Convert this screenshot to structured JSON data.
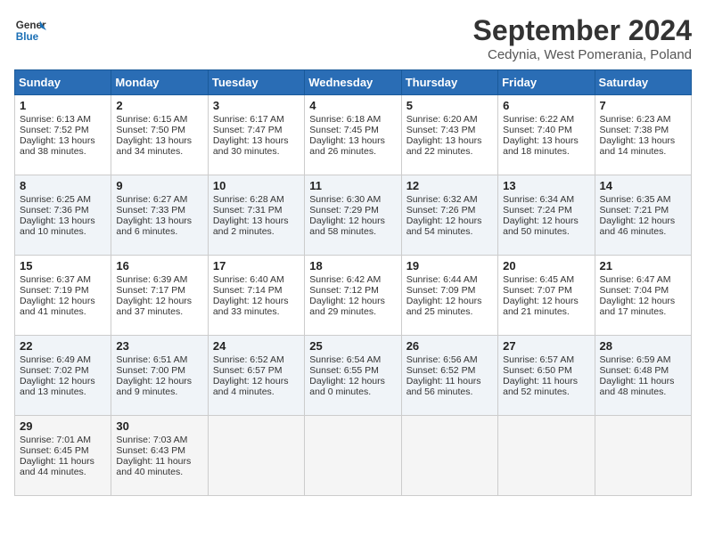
{
  "header": {
    "logo_line1": "General",
    "logo_line2": "Blue",
    "title": "September 2024",
    "location": "Cedynia, West Pomerania, Poland"
  },
  "weekdays": [
    "Sunday",
    "Monday",
    "Tuesday",
    "Wednesday",
    "Thursday",
    "Friday",
    "Saturday"
  ],
  "weeks": [
    [
      {
        "day": "1",
        "lines": [
          "Sunrise: 6:13 AM",
          "Sunset: 7:52 PM",
          "Daylight: 13 hours",
          "and 38 minutes."
        ]
      },
      {
        "day": "2",
        "lines": [
          "Sunrise: 6:15 AM",
          "Sunset: 7:50 PM",
          "Daylight: 13 hours",
          "and 34 minutes."
        ]
      },
      {
        "day": "3",
        "lines": [
          "Sunrise: 6:17 AM",
          "Sunset: 7:47 PM",
          "Daylight: 13 hours",
          "and 30 minutes."
        ]
      },
      {
        "day": "4",
        "lines": [
          "Sunrise: 6:18 AM",
          "Sunset: 7:45 PM",
          "Daylight: 13 hours",
          "and 26 minutes."
        ]
      },
      {
        "day": "5",
        "lines": [
          "Sunrise: 6:20 AM",
          "Sunset: 7:43 PM",
          "Daylight: 13 hours",
          "and 22 minutes."
        ]
      },
      {
        "day": "6",
        "lines": [
          "Sunrise: 6:22 AM",
          "Sunset: 7:40 PM",
          "Daylight: 13 hours",
          "and 18 minutes."
        ]
      },
      {
        "day": "7",
        "lines": [
          "Sunrise: 6:23 AM",
          "Sunset: 7:38 PM",
          "Daylight: 13 hours",
          "and 14 minutes."
        ]
      }
    ],
    [
      {
        "day": "8",
        "lines": [
          "Sunrise: 6:25 AM",
          "Sunset: 7:36 PM",
          "Daylight: 13 hours",
          "and 10 minutes."
        ]
      },
      {
        "day": "9",
        "lines": [
          "Sunrise: 6:27 AM",
          "Sunset: 7:33 PM",
          "Daylight: 13 hours",
          "and 6 minutes."
        ]
      },
      {
        "day": "10",
        "lines": [
          "Sunrise: 6:28 AM",
          "Sunset: 7:31 PM",
          "Daylight: 13 hours",
          "and 2 minutes."
        ]
      },
      {
        "day": "11",
        "lines": [
          "Sunrise: 6:30 AM",
          "Sunset: 7:29 PM",
          "Daylight: 12 hours",
          "and 58 minutes."
        ]
      },
      {
        "day": "12",
        "lines": [
          "Sunrise: 6:32 AM",
          "Sunset: 7:26 PM",
          "Daylight: 12 hours",
          "and 54 minutes."
        ]
      },
      {
        "day": "13",
        "lines": [
          "Sunrise: 6:34 AM",
          "Sunset: 7:24 PM",
          "Daylight: 12 hours",
          "and 50 minutes."
        ]
      },
      {
        "day": "14",
        "lines": [
          "Sunrise: 6:35 AM",
          "Sunset: 7:21 PM",
          "Daylight: 12 hours",
          "and 46 minutes."
        ]
      }
    ],
    [
      {
        "day": "15",
        "lines": [
          "Sunrise: 6:37 AM",
          "Sunset: 7:19 PM",
          "Daylight: 12 hours",
          "and 41 minutes."
        ]
      },
      {
        "day": "16",
        "lines": [
          "Sunrise: 6:39 AM",
          "Sunset: 7:17 PM",
          "Daylight: 12 hours",
          "and 37 minutes."
        ]
      },
      {
        "day": "17",
        "lines": [
          "Sunrise: 6:40 AM",
          "Sunset: 7:14 PM",
          "Daylight: 12 hours",
          "and 33 minutes."
        ]
      },
      {
        "day": "18",
        "lines": [
          "Sunrise: 6:42 AM",
          "Sunset: 7:12 PM",
          "Daylight: 12 hours",
          "and 29 minutes."
        ]
      },
      {
        "day": "19",
        "lines": [
          "Sunrise: 6:44 AM",
          "Sunset: 7:09 PM",
          "Daylight: 12 hours",
          "and 25 minutes."
        ]
      },
      {
        "day": "20",
        "lines": [
          "Sunrise: 6:45 AM",
          "Sunset: 7:07 PM",
          "Daylight: 12 hours",
          "and 21 minutes."
        ]
      },
      {
        "day": "21",
        "lines": [
          "Sunrise: 6:47 AM",
          "Sunset: 7:04 PM",
          "Daylight: 12 hours",
          "and 17 minutes."
        ]
      }
    ],
    [
      {
        "day": "22",
        "lines": [
          "Sunrise: 6:49 AM",
          "Sunset: 7:02 PM",
          "Daylight: 12 hours",
          "and 13 minutes."
        ]
      },
      {
        "day": "23",
        "lines": [
          "Sunrise: 6:51 AM",
          "Sunset: 7:00 PM",
          "Daylight: 12 hours",
          "and 9 minutes."
        ]
      },
      {
        "day": "24",
        "lines": [
          "Sunrise: 6:52 AM",
          "Sunset: 6:57 PM",
          "Daylight: 12 hours",
          "and 4 minutes."
        ]
      },
      {
        "day": "25",
        "lines": [
          "Sunrise: 6:54 AM",
          "Sunset: 6:55 PM",
          "Daylight: 12 hours",
          "and 0 minutes."
        ]
      },
      {
        "day": "26",
        "lines": [
          "Sunrise: 6:56 AM",
          "Sunset: 6:52 PM",
          "Daylight: 11 hours",
          "and 56 minutes."
        ]
      },
      {
        "day": "27",
        "lines": [
          "Sunrise: 6:57 AM",
          "Sunset: 6:50 PM",
          "Daylight: 11 hours",
          "and 52 minutes."
        ]
      },
      {
        "day": "28",
        "lines": [
          "Sunrise: 6:59 AM",
          "Sunset: 6:48 PM",
          "Daylight: 11 hours",
          "and 48 minutes."
        ]
      }
    ],
    [
      {
        "day": "29",
        "lines": [
          "Sunrise: 7:01 AM",
          "Sunset: 6:45 PM",
          "Daylight: 11 hours",
          "and 44 minutes."
        ]
      },
      {
        "day": "30",
        "lines": [
          "Sunrise: 7:03 AM",
          "Sunset: 6:43 PM",
          "Daylight: 11 hours",
          "and 40 minutes."
        ]
      },
      {
        "day": "",
        "lines": []
      },
      {
        "day": "",
        "lines": []
      },
      {
        "day": "",
        "lines": []
      },
      {
        "day": "",
        "lines": []
      },
      {
        "day": "",
        "lines": []
      }
    ]
  ]
}
